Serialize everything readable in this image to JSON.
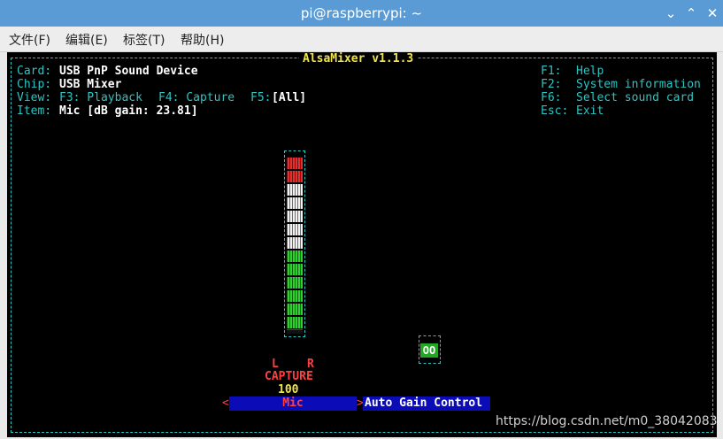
{
  "window": {
    "title": "pi@raspberrypi: ~",
    "minimize": "⌄",
    "maximize": "⌃",
    "close": "✕"
  },
  "menu": {
    "file": "文件(F)",
    "edit": "编辑(E)",
    "tags": "标签(T)",
    "help": "帮助(H)"
  },
  "mixer": {
    "title": "AlsaMixer v1.1.3",
    "card_label": "Card:",
    "card_value": "USB PnP Sound Device",
    "chip_label": "Chip:",
    "chip_value": "USB Mixer",
    "view_label": "View:",
    "view_f3": "F3: Playback",
    "view_f4": "F4: Capture",
    "view_f5_key": "F5:",
    "view_f5_value": "[All]",
    "item_label": "Item:",
    "item_value": "Mic [dB gain: 23.81]",
    "help_f1_key": "F1:",
    "help_f1_text": "Help",
    "help_f2_key": "F2:",
    "help_f2_text": "System information",
    "help_f6_key": "F6:",
    "help_f6_text": "Select sound card",
    "help_esc_key": "Esc:",
    "help_esc_text": "Exit",
    "channel_left": "L",
    "channel_right": "R",
    "capture_label": "CAPTURE",
    "capture_value": "100",
    "volume_level_percent": 100,
    "switch_value": "OO",
    "control_arrow_left": "<",
    "control_arrow_right": ">",
    "control_mic": "Mic",
    "control_agc": "Auto Gain Control"
  },
  "watermark": "https://blog.csdn.net/m0_38042083",
  "colors": {
    "terminal_bg": "#000000",
    "cyan": "#2ec4c4",
    "yellow": "#f0e54a",
    "red": "#ff4040",
    "selection_blue": "#0b0bb8",
    "titlebar": "#5b9bd5"
  }
}
